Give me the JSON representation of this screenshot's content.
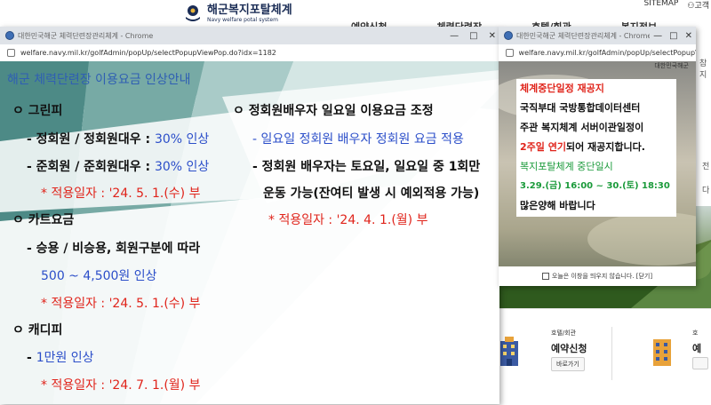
{
  "site": {
    "logo_main": "해군복지포탈체계",
    "logo_sub": "Navy welfare potal system",
    "top_links": [
      "SITEMAP",
      "고객"
    ],
    "gnb": [
      "예약신청",
      "체력단련장",
      "호텔/회관",
      "복지정보"
    ],
    "side_texts": [
      "참지",
      "전",
      "다"
    ],
    "quick_cards": [
      {
        "sub": "호텔/회관",
        "title": "예약신청",
        "button": "바로가기"
      },
      {
        "sub": "호",
        "title": "예",
        "button": ""
      }
    ]
  },
  "popup1": {
    "window_title": "대한민국해군 체력단련장관리체계 - Chrome",
    "url": "welfare.navy.mil.kr/golfAdmin/popUp/selectPopupViewPop.do?idx=1182",
    "heading": "해군 체력단련장 이용요금 인상안내",
    "sections": {
      "greenfee": {
        "title": "ㅇ 그린피",
        "line1_a": "- 정회원 / 정회원대우 : ",
        "line1_b": "30% 인상",
        "line2_a": "- 준회원 / 준회원대우 : ",
        "line2_b": "30% 인상",
        "date": "* 적용일자 : '24. 5. 1.(수) 부"
      },
      "cart": {
        "title": "ㅇ 카트요금",
        "line1": "- 승용 / 비승용, 회원구분에 따라",
        "line2": "500 ~ 4,500원 인상",
        "date": "* 적용일자 : '24. 5. 1.(수) 부"
      },
      "caddie": {
        "title": "ㅇ 캐디피",
        "line1_a": "- ",
        "line1_b": "1만원 인상",
        "date": "* 적용일자 : '24. 7. 1.(월) 부"
      },
      "spouse": {
        "title": "ㅇ 정회원배우자 일요일 이용요금 조정",
        "line1": "- 일요일 정회원 배우자 정회원 요금 적용",
        "line2": "- 정회원 배우자는 토요일, 일요일 중 1회만",
        "line3": "운동 가능(잔여티 발생 시 예외적용 가능)",
        "date": "* 적용일자 : '24. 4. 1.(월) 부"
      }
    }
  },
  "popup2": {
    "window_title": "대한민국해군 체력단련장관리체계 - Chrome",
    "url": "welfare.navy.mil.kr/golfAdmin/popUp/selectPopupVi...",
    "ribbon": "대한민국해군",
    "notice": {
      "title": "체계중단일정 재공지",
      "line1": "국직부대 국방통합데이터센터",
      "line2": "주관 복지체계 서버이관일정이",
      "line3_red": "2주일 연기",
      "line3_rest": "되어 재공지합니다.",
      "sub_title": "복지포탈체계 중단일시",
      "period": "3.29.(금) 16:00 ~ 30.(토) 18:30",
      "closing": "많은양해 바랍니다"
    },
    "footer": "오늘은 이창을 띄우지 않습니다. [닫기]"
  },
  "colors": {
    "heading_blue": "#2f5fb3",
    "accent_blue": "#2b4ec9",
    "accent_red": "#e0241b",
    "notice_green": "#1a9a3a",
    "teal_bg": "#5f9c97"
  }
}
